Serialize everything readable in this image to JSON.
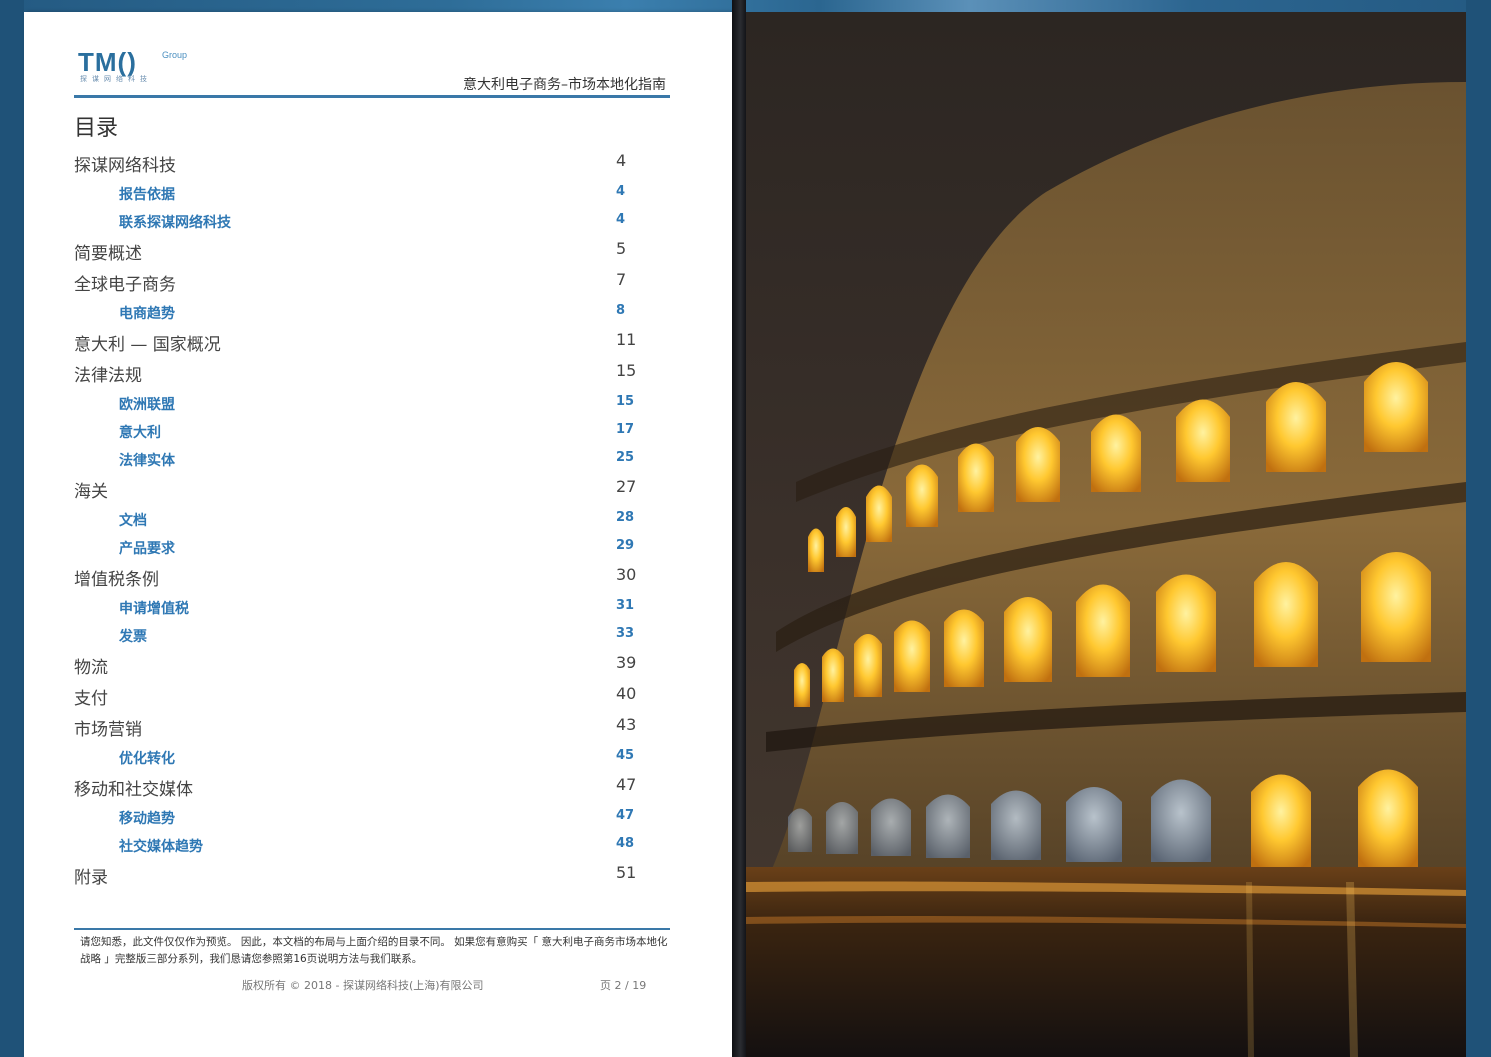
{
  "header": {
    "logo_mark": "TM()",
    "logo_group": "Group",
    "logo_cn": "探谋网络科技",
    "doc_title": "意大利电子商务–市场本地化指南"
  },
  "toc": {
    "title": "目录",
    "entries": [
      {
        "label": "探谋网络科技",
        "page": "4",
        "level": 1
      },
      {
        "label": "报告依据",
        "page": "4",
        "level": 2
      },
      {
        "label": "联系探谋网络科技",
        "page": "4",
        "level": 2
      },
      {
        "label": "简要概述",
        "page": "5",
        "level": 1
      },
      {
        "label": "全球电子商务",
        "page": "7",
        "level": 1
      },
      {
        "label": "电商趋势",
        "page": "8",
        "level": 2
      },
      {
        "label": "意大利 — 国家概况",
        "page": "11",
        "level": 1
      },
      {
        "label": "法律法规",
        "page": "15",
        "level": 1
      },
      {
        "label": "欧洲联盟",
        "page": "15",
        "level": 2
      },
      {
        "label": "意大利",
        "page": "17",
        "level": 2
      },
      {
        "label": "法律实体",
        "page": "25",
        "level": 2
      },
      {
        "label": "海关",
        "page": "27",
        "level": 1
      },
      {
        "label": "文档",
        "page": "28",
        "level": 2
      },
      {
        "label": "产品要求",
        "page": "29",
        "level": 2
      },
      {
        "label": "增值税条例",
        "page": "30",
        "level": 1
      },
      {
        "label": "申请增值税",
        "page": "31",
        "level": 2
      },
      {
        "label": "发票",
        "page": "33",
        "level": 2
      },
      {
        "label": "物流",
        "page": "39",
        "level": 1
      },
      {
        "label": "支付",
        "page": "40",
        "level": 1
      },
      {
        "label": "市场营销",
        "page": "43",
        "level": 1
      },
      {
        "label": "优化转化",
        "page": "45",
        "level": 2
      },
      {
        "label": "移动和社交媒体",
        "page": "47",
        "level": 1
      },
      {
        "label": "移动趋势",
        "page": "47",
        "level": 2
      },
      {
        "label": "社交媒体趋势",
        "page": "48",
        "level": 2
      },
      {
        "label": "附录",
        "page": "51",
        "level": 1
      }
    ]
  },
  "footer": {
    "notice": "请您知悉，此文件仅仅作为预览。 因此，本文档的布局与上面介绍的目录不同。 如果您有意购买「 意大利电子商务市场本地化战略 」完整版三部分系列，我们恳请您参照第16页说明方法与我们联系。",
    "copyright": "版权所有 © 2018 - 探谋网络科技(上海)有限公司",
    "page_indicator": "页 2 / 19"
  },
  "photo": {
    "subject": "colosseum-night-photo"
  }
}
